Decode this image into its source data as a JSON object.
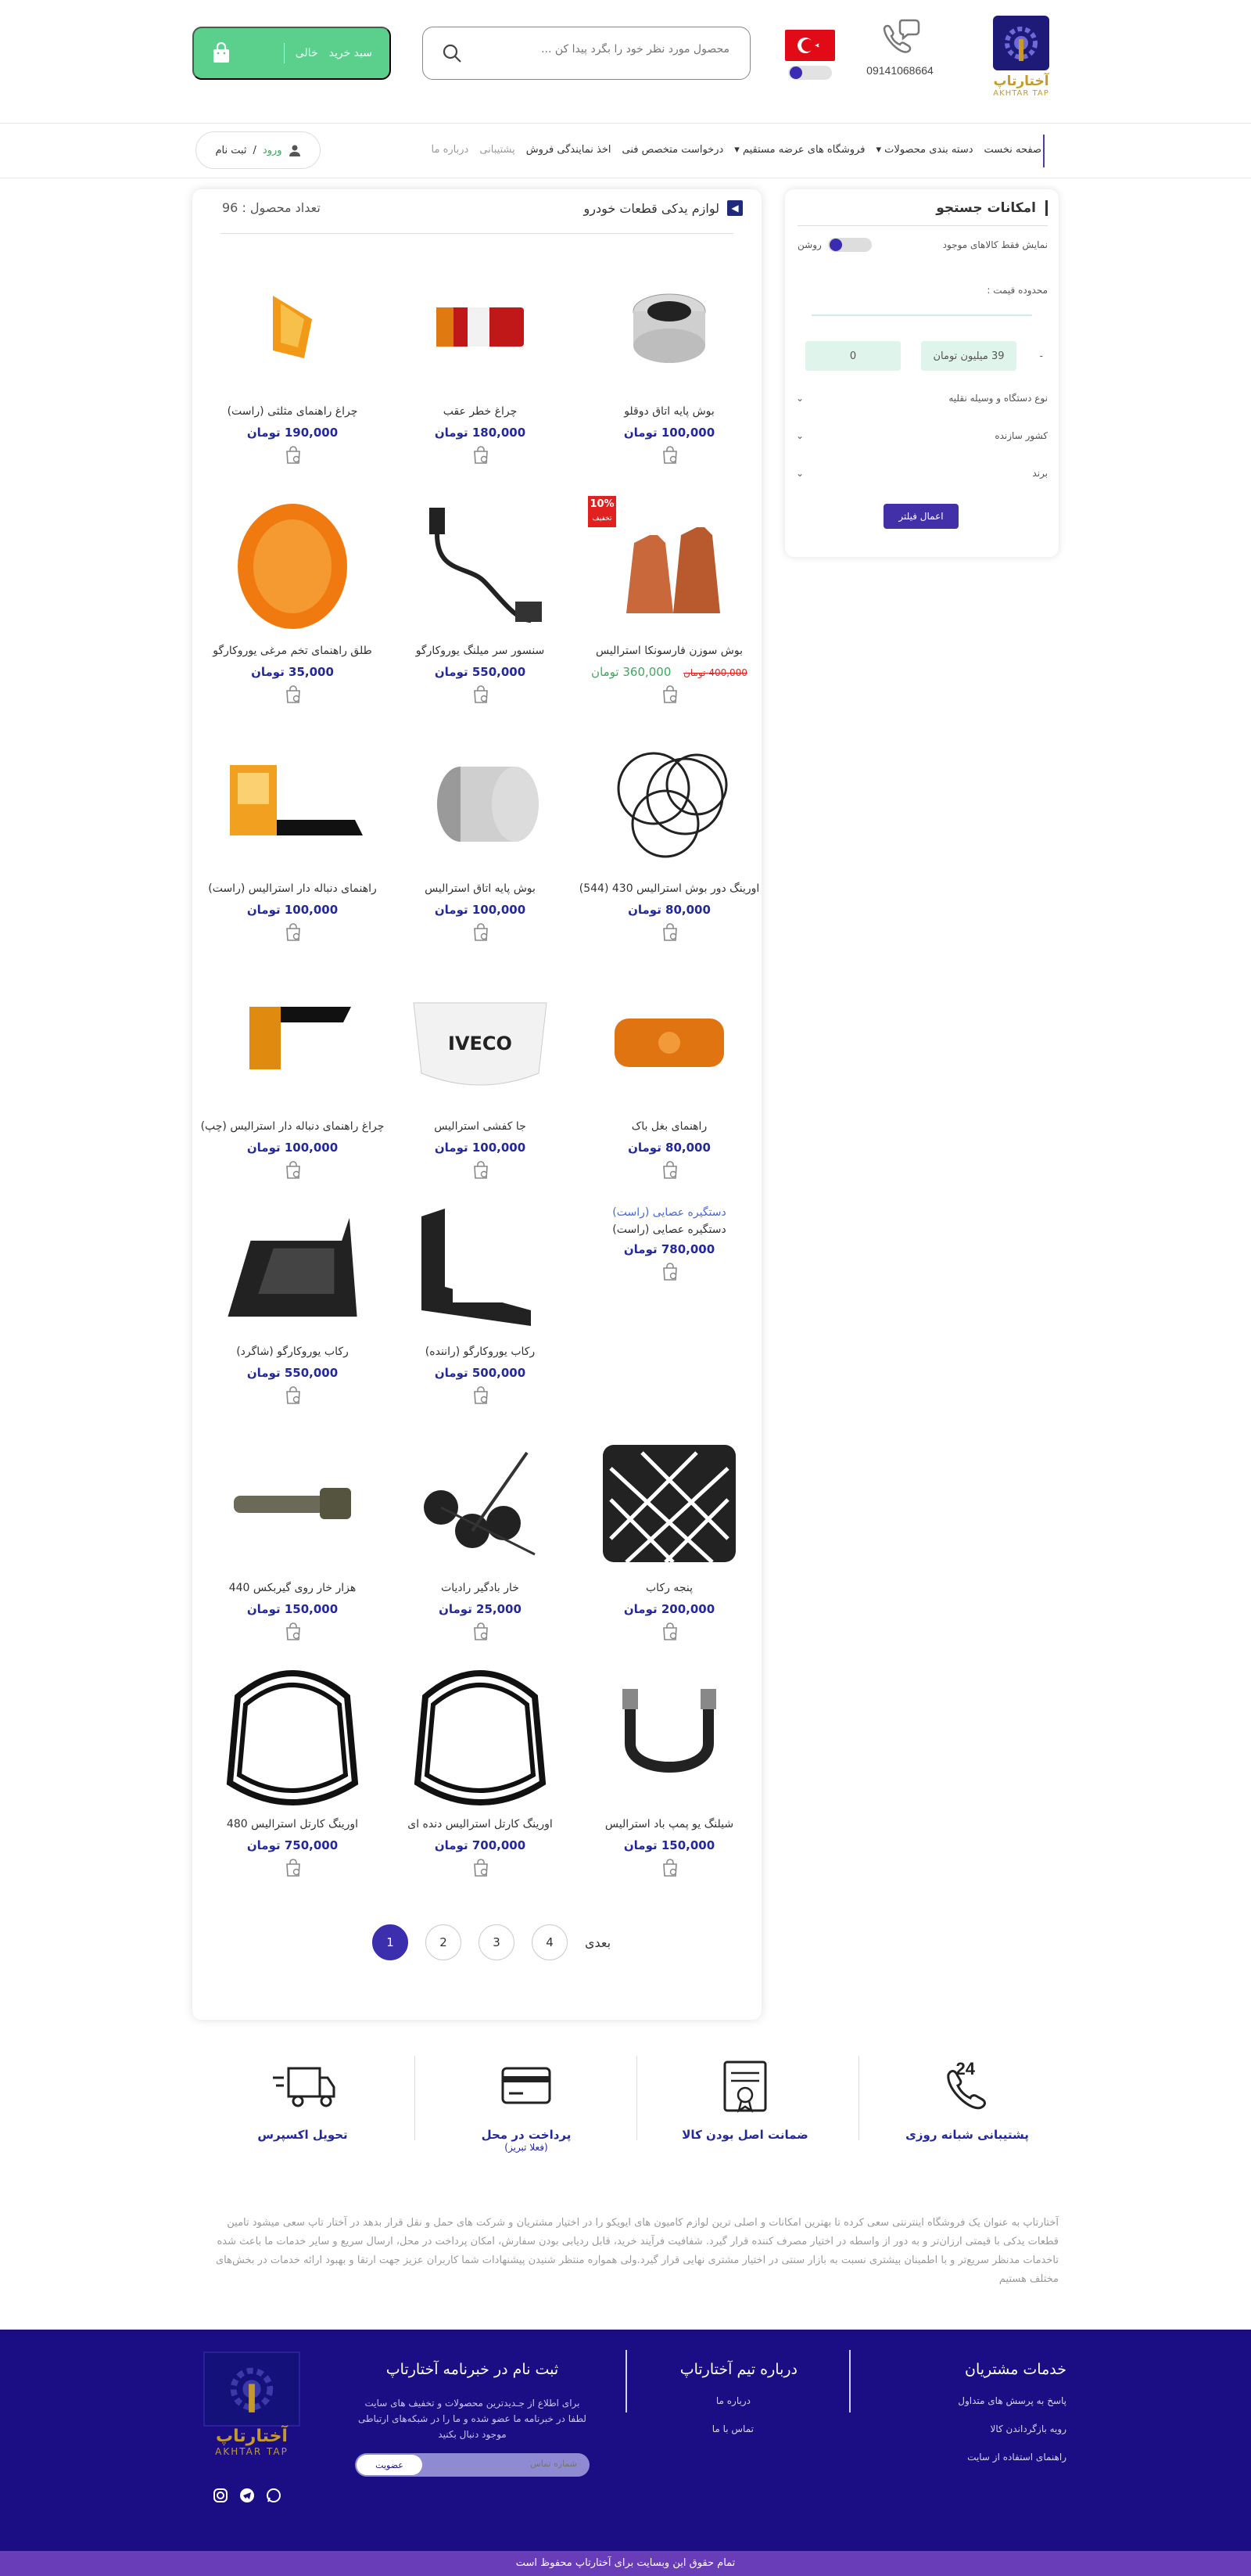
{
  "header": {
    "logo_fa": "آختارتاپ",
    "logo_en": "AKHTAR TAP",
    "phone": "09141068664",
    "search_placeholder": "محصول مورد نظر خود را بگرد پیدا کن ...",
    "cart_label": "سبد خرید",
    "cart_status": "خالی"
  },
  "nav": {
    "items": [
      "صفحه نخست",
      "دسته بندی محصولات",
      "فروشگاه های عرضه مستقیم",
      "درخواست متخصص فنی",
      "اخذ نمایندگی فروش",
      "پشتیبانی",
      "درباره ما"
    ],
    "login": "ورود",
    "register": "ثبت نام"
  },
  "sidebar": {
    "title": "امکانات جستجو",
    "only_available": "نمایش فقط کالاهای موجود",
    "toggle_label": "روشن",
    "price_range": "محدوده قیمت :",
    "price_max": "39 میلیون تومان",
    "price_min": "0",
    "dash": "-",
    "filters": [
      "نوع دستگاه و وسیله نقلیه",
      "کشور سازنده",
      "برند"
    ],
    "apply": "اعمال فیلتر"
  },
  "listing": {
    "title": "لوازم یدکی قطعات خودرو",
    "count_label": "تعداد محصول :",
    "count": "96",
    "badge_pct": "10%",
    "badge_txt": "تخفیف",
    "products": [
      {
        "name": "بوش پایه اتاق دوقلو",
        "price": "100,000 تومان",
        "img": "bushing"
      },
      {
        "name": "چراغ خطر عقب",
        "price": "180,000 تومان",
        "img": "taillight"
      },
      {
        "name": "چراغ راهنمای مثلثی (راست)",
        "price": "190,000 تومان",
        "img": "indicator"
      },
      {
        "name": "بوش سوزن فارسونکا استرالیس",
        "old_price": "400,000 تومان",
        "price": "360,000 تومان",
        "img": "copper",
        "discount": true
      },
      {
        "name": "سنسور سر میلنگ یوروکارگو",
        "price": "550,000 تومان",
        "img": "sensor"
      },
      {
        "name": "طلق راهنمای تخم مرغی یوروکارگو",
        "price": "35,000 تومان",
        "img": "orange-oval"
      },
      {
        "name": "اورینگ دور بوش استرالیس 430 (544)",
        "price": "80,000 تومان",
        "img": "orings"
      },
      {
        "name": "بوش پایه اتاق استرالیس",
        "price": "100,000 تومان",
        "img": "bushing2"
      },
      {
        "name": "راهنمای دنباله دار استرالیس (راست)",
        "price": "100,000 تومان",
        "img": "indicator-long"
      },
      {
        "name": "راهنمای بغل باک",
        "price": "80,000 تومان",
        "img": "side-marker"
      },
      {
        "name": "جا کفشی استرالیس",
        "price": "100,000 تومان",
        "img": "iveco"
      },
      {
        "name": "چراغ راهنمای دنباله دار استرالیس (چپ)",
        "price": "100,000 تومان",
        "img": "indicator-left"
      },
      {
        "name": "دستگیره عصایی (راست)",
        "price": "780,000 تومان",
        "img": "broken",
        "alt": "دستگیره عصایی (راست)"
      },
      {
        "name": "رکاب یوروکارگو (راننده)",
        "price": "500,000 تومان",
        "img": "step"
      },
      {
        "name": "رکاب یوروکارگو (شاگرد)",
        "price": "550,000 تومان",
        "img": "step2"
      },
      {
        "name": "پنجه رکاب",
        "price": "200,000 تومان",
        "img": "grid"
      },
      {
        "name": "خار بادگیر رادیات",
        "price": "25,000 تومان",
        "img": "clips"
      },
      {
        "name": "هزار خار روی گیربکس 440",
        "price": "150,000 تومان",
        "img": "shaft"
      },
      {
        "name": "شیلنگ یو پمپ باد استرالیس",
        "price": "150,000 تومان",
        "img": "hose"
      },
      {
        "name": "اورینگ کارتل استرالیس دنده ای",
        "price": "700,000 تومان",
        "img": "gasket"
      },
      {
        "name": "اورینگ کارتل استرالیس 480",
        "price": "750,000 تومان",
        "img": "gasket"
      }
    ]
  },
  "pagination": {
    "pages": [
      "1",
      "2",
      "3",
      "4"
    ],
    "next": "بعدی"
  },
  "features": [
    {
      "title": "پشتیبانی شبانه روزی",
      "sub": "",
      "icon": "phone-24-icon"
    },
    {
      "title": "ضمانت اصل بودن کالا",
      "sub": "",
      "icon": "certificate-icon"
    },
    {
      "title": "پرداخت در محل",
      "sub": "(فعلا تبریز)",
      "icon": "card-icon"
    },
    {
      "title": "تحویل اکسپرس",
      "sub": "",
      "icon": "truck-icon"
    }
  ],
  "about": "آختارتاپ به عنوان یک فروشگاه اینترنتی سعی کرده تا بهترین امکانات و اصلی ترین لوازم کامیون های ایویکو را در اختیار مشتریان و شرکت های حمل و نقل قرار بدهد در آختار تاپ سعی میشود تامین قطعات یدکی با قیمتی ارزان‌تر و به دور از واسطه در اختیار مصرف کننده قرار گیرد. شفافیت فرآیند خرید، قابل ردیابی بودن سفارش، امکان پرداخت در محل، ارسال سریع و سایر خدمات ما باعث شده تاخدمات مدنظر سریع‌تر و با اطمینان بیشتری نسبت به بازار سنتی در اختیار مشتری نهایی قرار گیرد.ولی همواره منتظر شنیدن پیشنهادات شما کاربران عزیز جهت ارتقا و بهبود ارائه خدمات در بخش‌های مختلف هستیم",
  "footer": {
    "services_title": "خدمات مشتریان",
    "services": [
      "پاسخ به پرسش های متداول",
      "رویه بازگرداندن کالا",
      "راهنمای استفاده از سایت"
    ],
    "team_title": "درباره تیم آختارتاپ",
    "team": [
      "درباره ما",
      "تماس با ما"
    ],
    "news_title": "ثبت نام در خبرنامه آختارتاپ",
    "news_text": "برای اطلاع از جـدیدترین محصولات و تخفیف های سایت لطفا در خبرنامه ما عضو شده و ما را در شبکه‌های ارتباطی موجود دنبال بکنید",
    "news_placeholder": "شماره تماس",
    "news_button": "عضویت",
    "copyright": "تمام حقوق این وبسایت برای آختارتاپ محفوظ است"
  },
  "colors": {
    "accent": "#3b2fae",
    "green": "#5bcf8c",
    "footer": "#1b0e85",
    "price": "#23299a"
  }
}
